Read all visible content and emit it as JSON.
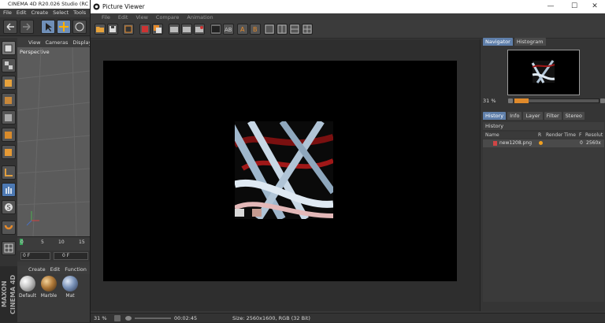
{
  "c4d": {
    "title": "CINEMA 4D R20.026 Studio (RC",
    "menu": [
      "File",
      "Edit",
      "Create",
      "Select",
      "Tools"
    ],
    "viewport_menu": [
      "View",
      "Cameras",
      "Display"
    ],
    "viewport_label": "Perspective",
    "timeline_ticks": [
      "0",
      "5",
      "10",
      "15"
    ],
    "frame_field": "0 F",
    "frame_field2": "0 F",
    "material_menu": [
      "Create",
      "Edit",
      "Function"
    ],
    "materials": [
      {
        "name": "Default",
        "color": "#c8c8c8"
      },
      {
        "name": "Marble",
        "color": "#b07a3a"
      },
      {
        "name": "Mat",
        "color": "#7a92b8"
      }
    ],
    "brand": "MAXON CINEMA 4D"
  },
  "pv": {
    "title": "Picture Viewer",
    "controls": {
      "minimize": "—",
      "maximize": "☐",
      "close": "✕"
    },
    "menu": [
      "File",
      "Edit",
      "View",
      "Compare",
      "Animation"
    ],
    "status": {
      "zoom": "31 %",
      "time": "00:02:45",
      "info": "Size: 2560x1600, RGB (32 Bit)"
    }
  },
  "right": {
    "top_tabs": [
      "Navigator",
      "Histogram"
    ],
    "zoom": "31 %",
    "bottom_tabs": [
      "History",
      "Info",
      "Layer",
      "Filter",
      "Stereo"
    ],
    "history_title": "History",
    "columns": [
      "Name",
      "R",
      "Render Time",
      "F",
      "Resolut"
    ],
    "row": {
      "name": "new1208.png",
      "frame": "0",
      "resolution": "2560x"
    }
  }
}
